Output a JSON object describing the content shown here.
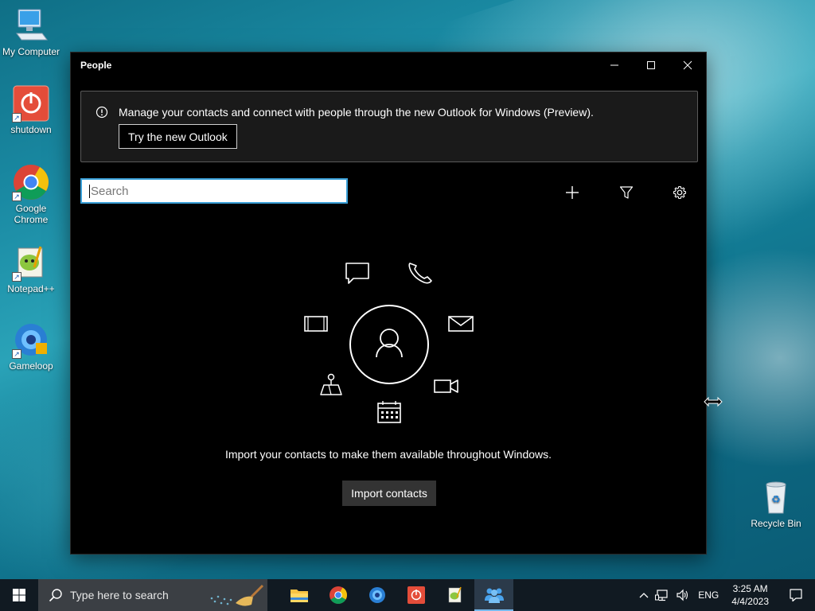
{
  "desktop": {
    "icons": [
      {
        "label": "My Computer"
      },
      {
        "label": "shutdown"
      },
      {
        "label": "Google Chrome"
      },
      {
        "label": "Notepad++"
      },
      {
        "label": "Gameloop"
      },
      {
        "label": "Recycle Bin"
      }
    ]
  },
  "window": {
    "title": "People",
    "banner": {
      "message": "Manage your contacts and connect with people through the new Outlook for Windows (Preview).",
      "button_label": "Try the new Outlook"
    },
    "search": {
      "placeholder": "Search"
    },
    "empty_state": {
      "text": "Import your contacts to make them available throughout Windows.",
      "button_label": "Import contacts"
    }
  },
  "taskbar": {
    "search_placeholder": "Type here to search",
    "pinned_apps": [
      "file-explorer",
      "google-chrome",
      "gameloop",
      "shutdown",
      "notepad-plus-plus",
      "people"
    ],
    "active_app": "people",
    "tray": {
      "language": "ENG",
      "time": "3:25 AM",
      "date": "4/4/2023"
    }
  },
  "colors": {
    "accent": "#3aa0d8",
    "window_bg": "#000000",
    "taskbar_bg": "#111a22"
  }
}
